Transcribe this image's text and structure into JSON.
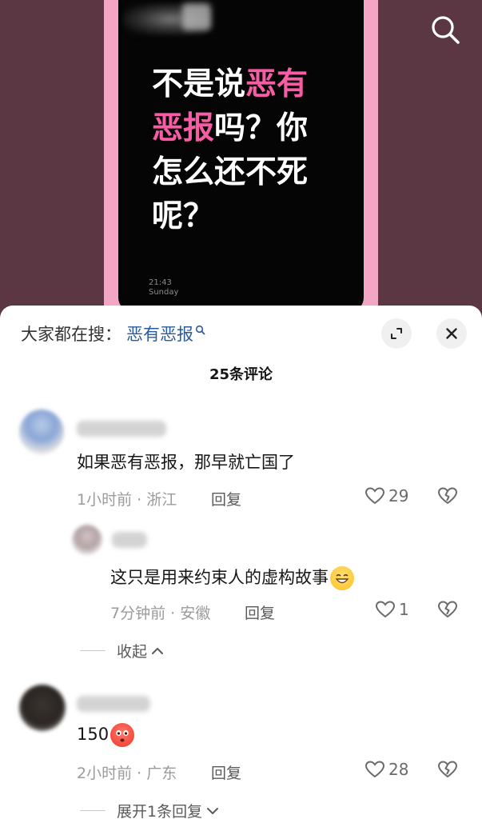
{
  "video": {
    "quote_parts": [
      {
        "text": "不是说",
        "pink": false
      },
      {
        "text": "恶有",
        "pink": true
      },
      {
        "text": "恶报",
        "pink": true
      },
      {
        "text": "吗？你怎么还不死呢？",
        "pink": false
      }
    ],
    "quote_line1a": "不是说",
    "quote_line1b": "恶有",
    "quote_line2a": "恶报",
    "quote_line2b": "吗？你",
    "quote_line3": "怎么还不死",
    "quote_line4": "呢？",
    "clock_time": "21:43",
    "clock_day": "Sunday",
    "accent_pink": "#f75da4",
    "frame_pink": "#f3a6c4"
  },
  "top_icons": {
    "search": "search-icon"
  },
  "sheet": {
    "hot_search_prefix": "大家都在搜：",
    "hot_search_term": "恶有恶报",
    "hot_search_term_color": "#2a5b9a",
    "comment_count": "25条评论"
  },
  "comments": [
    {
      "text": "如果恶有恶报，那早就亡国了",
      "time": "1小时前 · 浙江",
      "reply_label": "回复",
      "likes": "29"
    },
    {
      "text": "这只是用来约束人的虚构故事",
      "emoji": "grinning-face-emoji",
      "time": "7分钟前 · 安徽",
      "reply_label": "回复",
      "likes": "1"
    },
    {
      "text": "150",
      "emoji": "flushed-face-emoji",
      "time": "2小时前 · 广东",
      "reply_label": "回复",
      "likes": "28"
    }
  ],
  "collapse_label": "收起",
  "expand_label": "展开1条回复"
}
